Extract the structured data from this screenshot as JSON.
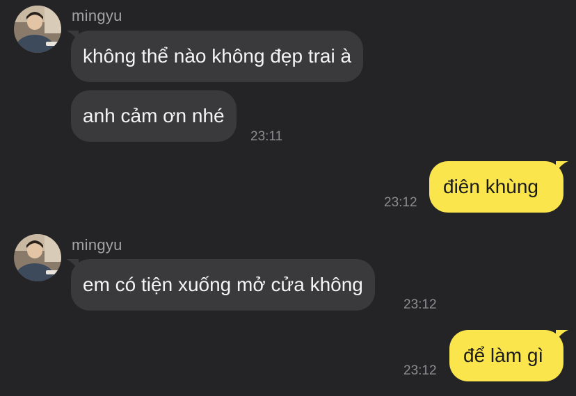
{
  "colors": {
    "background": "#242426",
    "incoming_bubble": "#3a3a3c",
    "outgoing_bubble": "#fbe54d",
    "incoming_text": "#f4f4f5",
    "outgoing_text": "#1b1b1b",
    "sender_name": "#a3a3a6",
    "timestamp": "#8d8d90"
  },
  "chat": {
    "groups": [
      {
        "sender": "mingyu",
        "avatar": "avatar-photo-icon",
        "messages": [
          {
            "text": "không thể nào không đẹp trai à"
          },
          {
            "text": "anh cảm ơn nhé",
            "time": "23:11"
          }
        ]
      },
      {
        "direction": "outgoing",
        "messages": [
          {
            "text": "điên khùng",
            "time": "23:12"
          }
        ]
      },
      {
        "sender": "mingyu",
        "avatar": "avatar-photo-icon",
        "messages": [
          {
            "text": "em có tiện xuống mở cửa không",
            "time": "23:12"
          }
        ]
      },
      {
        "direction": "outgoing",
        "messages": [
          {
            "text": "để làm gì",
            "time": "23:12"
          }
        ]
      }
    ]
  }
}
